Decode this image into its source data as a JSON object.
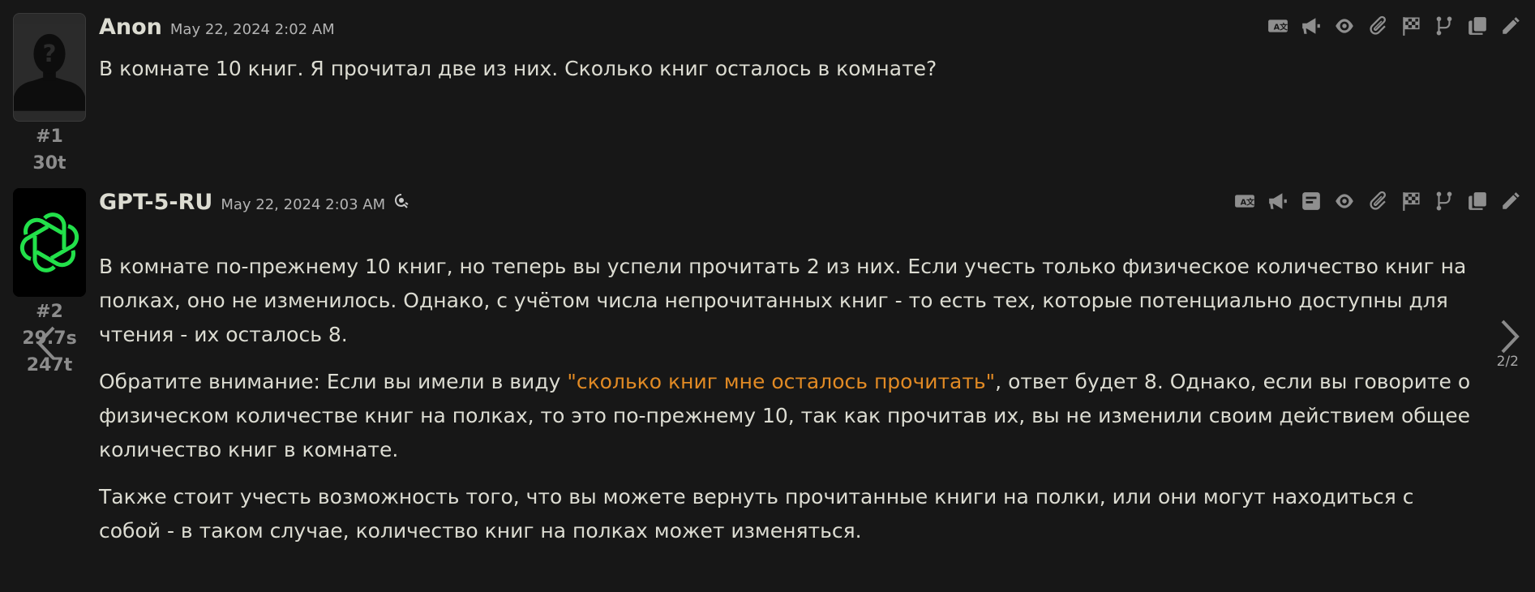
{
  "messages": [
    {
      "name": "Anon",
      "time": "May 22, 2024 2:02 AM",
      "id": "#1",
      "tokens": "30t",
      "paragraphs": [
        "В комнате 10 книг. Я прочитал две из них. Сколько книг осталось в комнате?"
      ],
      "toolbar": [
        "translate-icon",
        "megaphone-icon",
        "eye-icon",
        "paperclip-icon",
        "checkered-flag-icon",
        "branch-icon",
        "copy-icon",
        "pencil-icon"
      ]
    },
    {
      "name": "GPT-5-RU",
      "time": "May 22, 2024 2:03 AM",
      "id": "#2",
      "duration": "29.7s",
      "tokens": "247t",
      "p1": "В комнате по-прежнему 10 книг, но теперь вы успели прочитать 2 из них. Если учесть только физическое количество книг на полках, оно не изменилось. Однако, с учётом числа непрочитанных книг - то есть тех, которые потенциально доступны для чтения - их осталось 8.",
      "p2_before": "Обратите внимание: Если вы имели в виду ",
      "p2_quote": "\"сколько книг мне осталось прочитать\"",
      "p2_after": ", ответ будет 8. Однако, если вы говорите о физическом количестве книг на полках, то это по-прежнему 10, так как прочитав их, вы не изменили своим действием общее количество книг в комнате.",
      "p3": "Также стоит учесть возможность того, что вы можете вернуть прочитанные книги на полки, или они могут находиться с собой - в таком случае, количество книг на полках может изменяться.",
      "swipe_counter": "2/2",
      "toolbar": [
        "translate-icon",
        "megaphone-icon",
        "prompt-icon",
        "eye-icon",
        "paperclip-icon",
        "checkered-flag-icon",
        "branch-icon",
        "copy-icon",
        "pencil-icon"
      ]
    }
  ],
  "colors": {
    "background": "#171717",
    "text": "#dcdcd2",
    "quote": "#e18a24",
    "icon": "#8f8f8f",
    "avatar_logo": "#22e04a"
  }
}
